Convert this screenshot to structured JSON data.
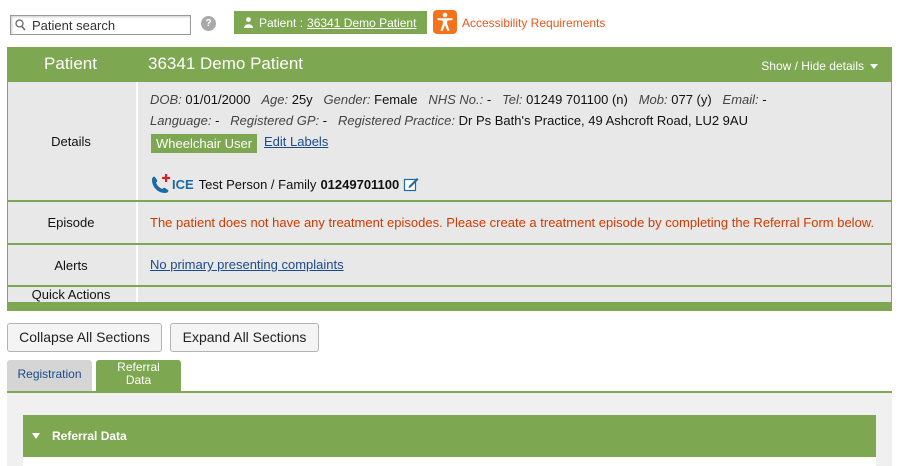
{
  "topbar": {
    "search_placeholder": "Patient search",
    "help_glyph": "?",
    "patient_prefix": "Patient :",
    "patient_link": "36341 Demo Patient",
    "accessibility_label": "Accessibility Requirements",
    "accessibility_color": "#f2731c"
  },
  "panel": {
    "header_label": "Patient",
    "patient_name": "36341 Demo Patient",
    "show_hide_label": "Show / Hide details",
    "accent_color": "#7da751",
    "rows": {
      "details_label": "Details",
      "episode_label": "Episode",
      "alerts_label": "Alerts",
      "quick_actions_label": "Quick Actions"
    },
    "details": {
      "dob_label": "DOB:",
      "dob": "01/01/2000",
      "age_label": "Age:",
      "age": "25y",
      "gender_label": "Gender:",
      "gender": "Female",
      "nhs_label": "NHS No.:",
      "nhs": "-",
      "tel_label": "Tel:",
      "tel": "01249 701100 (n)",
      "mob_label": "Mob:",
      "mob": "077 (y)",
      "email_label": "Email:",
      "email": "-",
      "language_label": "Language:",
      "language": "-",
      "gp_label": "Registered GP:",
      "gp": "-",
      "practice_label": "Registered Practice:",
      "practice": "Dr Ps Bath's Practice, 49 Ashcroft Road, LU2 9AU",
      "badge": "Wheelchair User",
      "edit_labels": "Edit Labels",
      "ice_label": "ICE",
      "ice_contact": "Test Person / Family",
      "ice_phone": "01249701100"
    },
    "episode_message": "The patient does not have any treatment episodes. Please create a treatment episode by completing the Referral Form below.",
    "episode_color": "#d03a00",
    "alerts_link": "No primary presenting complaints"
  },
  "actions": {
    "collapse_all": "Collapse All Sections",
    "expand_all": "Expand All Sections"
  },
  "tabs": {
    "registration": "Registration",
    "referral_line1": "Referral",
    "referral_line2": "Data"
  },
  "section": {
    "title": "Referral Data"
  }
}
